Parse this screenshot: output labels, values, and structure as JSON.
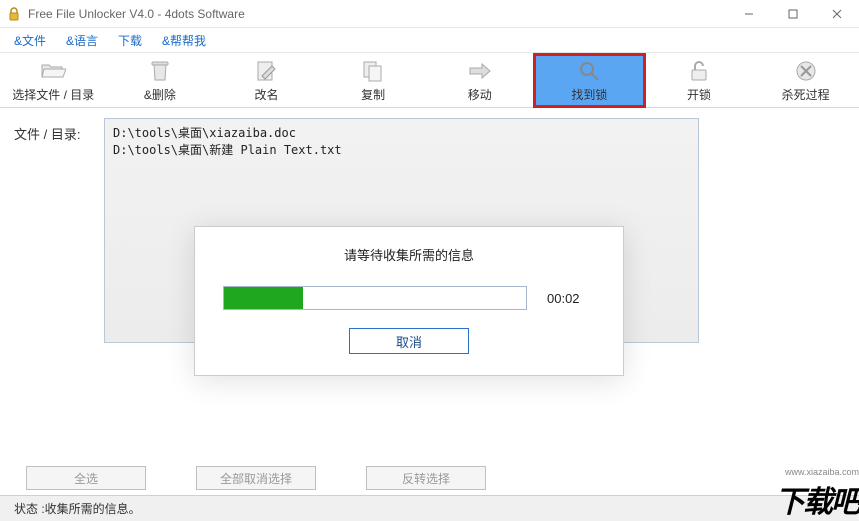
{
  "window": {
    "title": "Free File Unlocker V4.0 - 4dots Software"
  },
  "menu": {
    "file": "&文件",
    "language": "&语言",
    "download": "下载",
    "help": "&帮帮我"
  },
  "toolbar": {
    "select_files": "选择文件 / 目录",
    "delete": "&删除",
    "rename": "改名",
    "copy": "复制",
    "move": "移动",
    "find_lock": "找到锁",
    "unlock": "开锁",
    "kill_process": "杀死过程"
  },
  "main": {
    "files_label": "文件 / 目录:",
    "file_rows": [
      "D:\\tools\\桌面\\xiazaiba.doc",
      "D:\\tools\\桌面\\新建 Plain Text.txt"
    ]
  },
  "dialog": {
    "message": "请等待收集所需的信息",
    "time": "00:02",
    "cancel": "取消",
    "progress_percent": 26
  },
  "bottom": {
    "select_all": "全选",
    "deselect_all": "全部取消选择",
    "invert_selection": "反转选择"
  },
  "status": {
    "label": "状态 :",
    "text": "收集所需的信息。"
  },
  "watermark": {
    "site": "www.xiazaiba.com",
    "logo": "下载吧"
  }
}
